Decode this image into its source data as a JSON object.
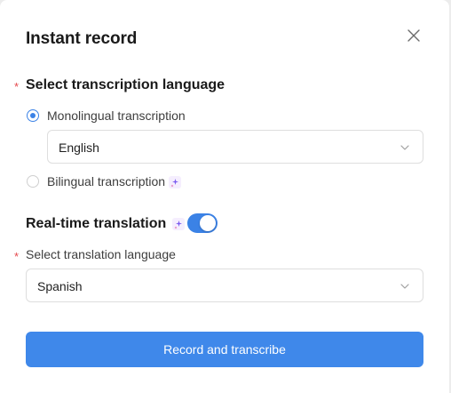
{
  "dialog": {
    "title": "Instant record"
  },
  "transcription": {
    "required_mark": "*",
    "section_label": "Select transcription language",
    "options": [
      {
        "label": "Monolingual transcription",
        "checked": true
      },
      {
        "label": "Bilingual transcription",
        "checked": false,
        "badge": "ai-sparkle-icon"
      }
    ],
    "language_value": "English"
  },
  "translation": {
    "label": "Real-time translation",
    "badge": "ai-sparkle-icon",
    "enabled": true,
    "required_mark": "*",
    "select_label": "Select translation language",
    "language_value": "Spanish"
  },
  "actions": {
    "primary_label": "Record and transcribe"
  },
  "colors": {
    "accent": "#3b82e6",
    "required": "#e5484d",
    "primary_button": "#3f88ea"
  }
}
